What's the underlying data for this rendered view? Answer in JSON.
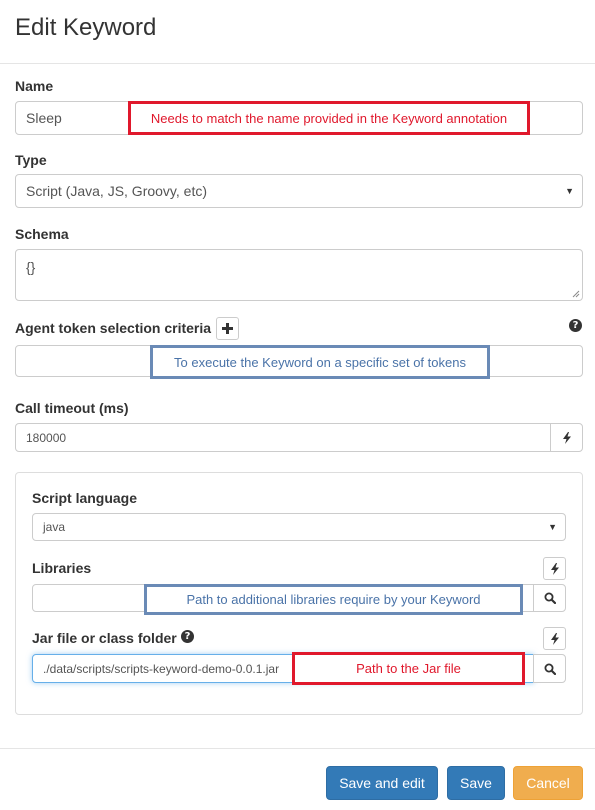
{
  "modal": {
    "title": "Edit Keyword"
  },
  "fields": {
    "name": {
      "label": "Name",
      "value": "Sleep"
    },
    "type": {
      "label": "Type",
      "value": "Script (Java, JS, Groovy, etc)"
    },
    "schema": {
      "label": "Schema",
      "value": "{}"
    },
    "agent_token": {
      "label": "Agent token selection criteria",
      "value": ""
    },
    "call_timeout": {
      "label": "Call timeout (ms)",
      "value": "180000"
    }
  },
  "script_panel": {
    "language": {
      "label": "Script language",
      "value": "java"
    },
    "libraries": {
      "label": "Libraries",
      "value": ""
    },
    "jar": {
      "label": "Jar file or class folder",
      "value": "./data/scripts/scripts-keyword-demo-0.0.1.jar"
    }
  },
  "annotations": {
    "name_note": "Needs to match the name provided in the Keyword annotation",
    "token_note": "To execute the Keyword on a specific set of tokens",
    "libraries_note": "Path to additional libraries require by your Keyword",
    "jar_note": "Path to the Jar file"
  },
  "footer": {
    "save_and_edit": "Save and edit",
    "save": "Save",
    "cancel": "Cancel"
  },
  "icons": {
    "add": "plus-icon",
    "help": "question-circle-icon",
    "dynamic": "bolt-icon",
    "search": "search-icon",
    "select": "caret-down-icon"
  },
  "colors": {
    "primary": "#337ab7",
    "warning": "#f0ad4e",
    "annotation_red": "#e0182c",
    "annotation_blue": "#6a8ab6"
  }
}
